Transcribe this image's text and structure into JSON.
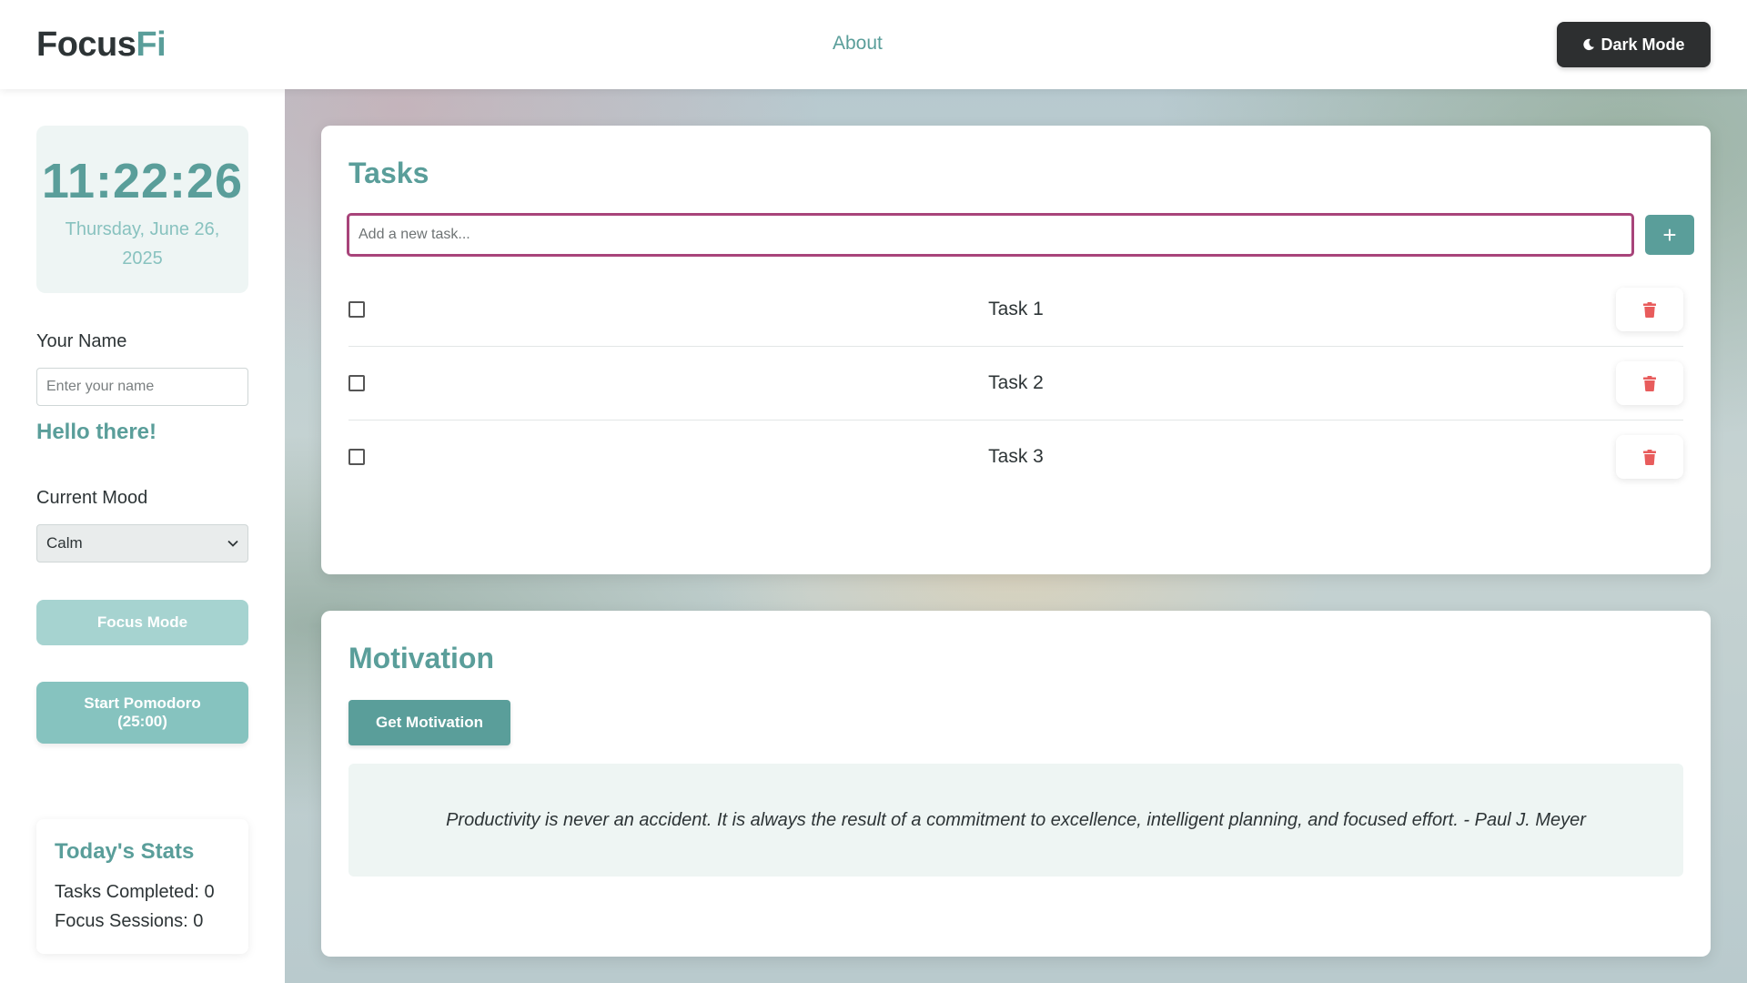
{
  "header": {
    "logo_main": "Focus",
    "logo_accent": "Fi",
    "nav_about": "About",
    "dark_mode_label": "Dark Mode",
    "dark_mode_icon": "moon-icon"
  },
  "sidebar": {
    "clock_time": "11:22:26",
    "clock_date": "Thursday, June 26, 2025",
    "name_label": "Your Name",
    "name_value": "",
    "name_placeholder": "Enter your name",
    "greeting": "Hello there!",
    "mood_label": "Current Mood",
    "mood_selected": "Calm",
    "focus_button": "Focus Mode",
    "pomodoro_button": "Start Pomodoro (25:00)",
    "stats": {
      "title": "Today's Stats",
      "tasks_completed": "Tasks Completed: 0",
      "focus_sessions": "Focus Sessions: 0"
    }
  },
  "tasks": {
    "title": "Tasks",
    "input_value": "",
    "input_placeholder": "Add a new task...",
    "add_button": "+",
    "items": [
      {
        "label": "Task 1",
        "checked": false,
        "delete_icon": "trash-icon"
      },
      {
        "label": "Task 2",
        "checked": false,
        "delete_icon": "trash-icon"
      },
      {
        "label": "Task 3",
        "checked": false,
        "delete_icon": "trash-icon"
      }
    ]
  },
  "motivation": {
    "title": "Motivation",
    "button": "Get Motivation",
    "quote": "Productivity is never an accident. It is always the result of a commitment to excellence, intelligent planning, and focused effort. - Paul J. Meyer"
  },
  "colors": {
    "accent": "#5a9e9a",
    "accent_light": "#88c2bf",
    "input_focus_border": "#a8447a",
    "delete_red": "#e85c5c",
    "dark_button": "#2d2f30"
  }
}
